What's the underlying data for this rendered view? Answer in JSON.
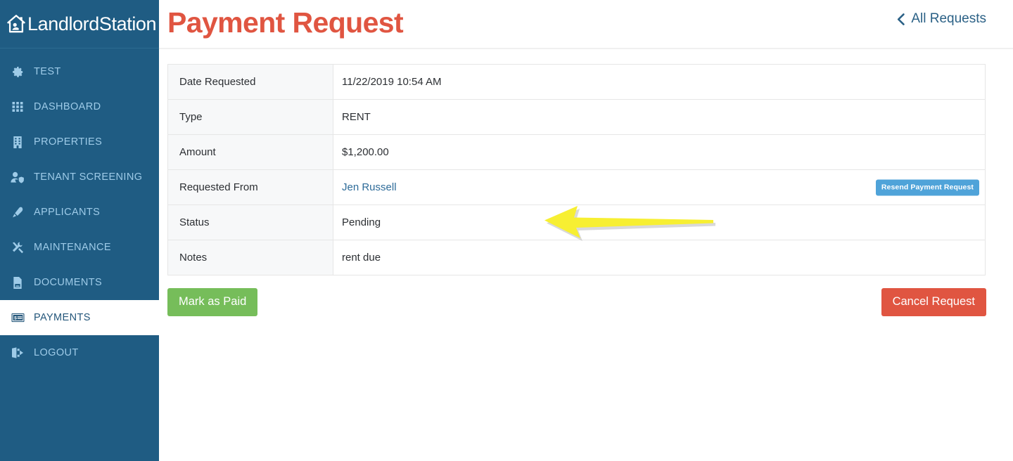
{
  "sidebar": {
    "brand": {
      "name": "LandlordStation",
      "icon": "house-icon"
    },
    "items": [
      {
        "label": "TEST",
        "icon": "gear-icon",
        "active": false
      },
      {
        "label": "DASHBOARD",
        "icon": "grid-icon",
        "active": false
      },
      {
        "label": "PROPERTIES",
        "icon": "building-icon",
        "active": false
      },
      {
        "label": "TENANT SCREENING",
        "icon": "user-shield-icon",
        "active": false
      },
      {
        "label": "APPLICANTS",
        "icon": "pen-icon",
        "active": false
      },
      {
        "label": "MAINTENANCE",
        "icon": "tools-icon",
        "active": false
      },
      {
        "label": "DOCUMENTS",
        "icon": "document-icon",
        "active": false
      },
      {
        "label": "PAYMENTS",
        "icon": "card-icon",
        "active": true
      },
      {
        "label": "LOGOUT",
        "icon": "logout-icon",
        "active": false
      }
    ]
  },
  "header": {
    "title": "Payment Request",
    "back_link": "All Requests",
    "back_icon": "chevron-left-icon"
  },
  "detail": {
    "rows": [
      {
        "label": "Date Requested",
        "value": "11/22/2019 10:54 AM",
        "type": "text"
      },
      {
        "label": "Type",
        "value": "RENT",
        "type": "text"
      },
      {
        "label": "Amount",
        "value": "$1,200.00",
        "type": "text"
      },
      {
        "label": "Requested From",
        "value": "Jen Russell",
        "type": "link"
      },
      {
        "label": "Status",
        "value": "Pending",
        "type": "text"
      },
      {
        "label": "Notes",
        "value": "rent due",
        "type": "text"
      }
    ],
    "resend_button": "Resend Payment Request"
  },
  "actions": {
    "mark_paid": "Mark as Paid",
    "cancel_request": "Cancel Request"
  },
  "annotation": {
    "type": "arrow",
    "points_at": "Pending",
    "color": "#f7ef32"
  },
  "colors": {
    "sidebar_bg": "#1f5c83",
    "sidebar_text": "#9ecbe8",
    "sidebar_active_bg": "#ffffff",
    "sidebar_active_text": "#23567a",
    "title_accent": "#e05541",
    "link": "#2d6b99",
    "success": "#76bd5a",
    "danger": "#e05541",
    "info": "#4fa3d9",
    "row_label_bg": "#f7f8f9",
    "border": "#e6e6e6",
    "annotation": "#f7ef32"
  }
}
